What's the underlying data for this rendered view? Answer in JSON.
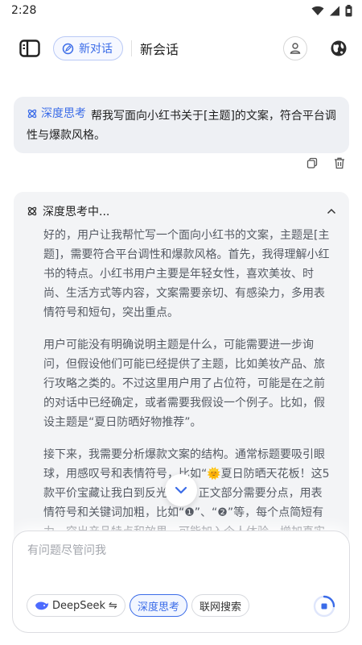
{
  "status_bar": {
    "time": "2:28"
  },
  "header": {
    "new_chat_label": "新对话",
    "session_title": "新会话"
  },
  "user_message": {
    "tag_label": "深度思考",
    "text": "帮我写面向小红书关于[主题]的文案，符合平台调性与爆款风格。"
  },
  "thinking": {
    "header_label": "深度思考中...",
    "paragraphs": [
      "好的，用户让我帮忙写一个面向小红书的文案，主题是[主题]，需要符合平台调性和爆款风格。首先，我得理解小红书的特点。小红书用户主要是年轻女性，喜欢美妆、时尚、生活方式等内容，文案需要亲切、有感染力，多用表情符号和短句，突出重点。",
      "用户可能没有明确说明主题是什么，可能需要进一步询问，但假设他们可能已经提供了主题，比如美妆产品、旅行攻略之类的。不过这里用户用了占位符，可能是在之前的对话中已经确定，或者需要我假设一个例子。比如，假设主题是“夏日防晒好物推荐”。",
      "接下来，我需要分析爆款文案的结构。通常标题要吸引眼球，用感叹号和表情符号，比如“🌞夏日防晒天花板！这5款平价宝藏让我白到反光✨”。正文部分需要分点，用表情符号和关键词加粗，比如“❶”、“❷”等，每个点简短有力，突出产品特点和效果，可能加入个人体验，增加真实感。"
    ]
  },
  "composer": {
    "placeholder": "有问题尽管问我",
    "model_label": "DeepSeek",
    "model_swap_glyph": "⇋",
    "deep_think_label": "深度思考",
    "web_search_label": "联网搜索"
  },
  "colors": {
    "accent": "#3b6ce8",
    "bubble": "#eef0f4",
    "thinking_bg": "#f3f4f6"
  }
}
